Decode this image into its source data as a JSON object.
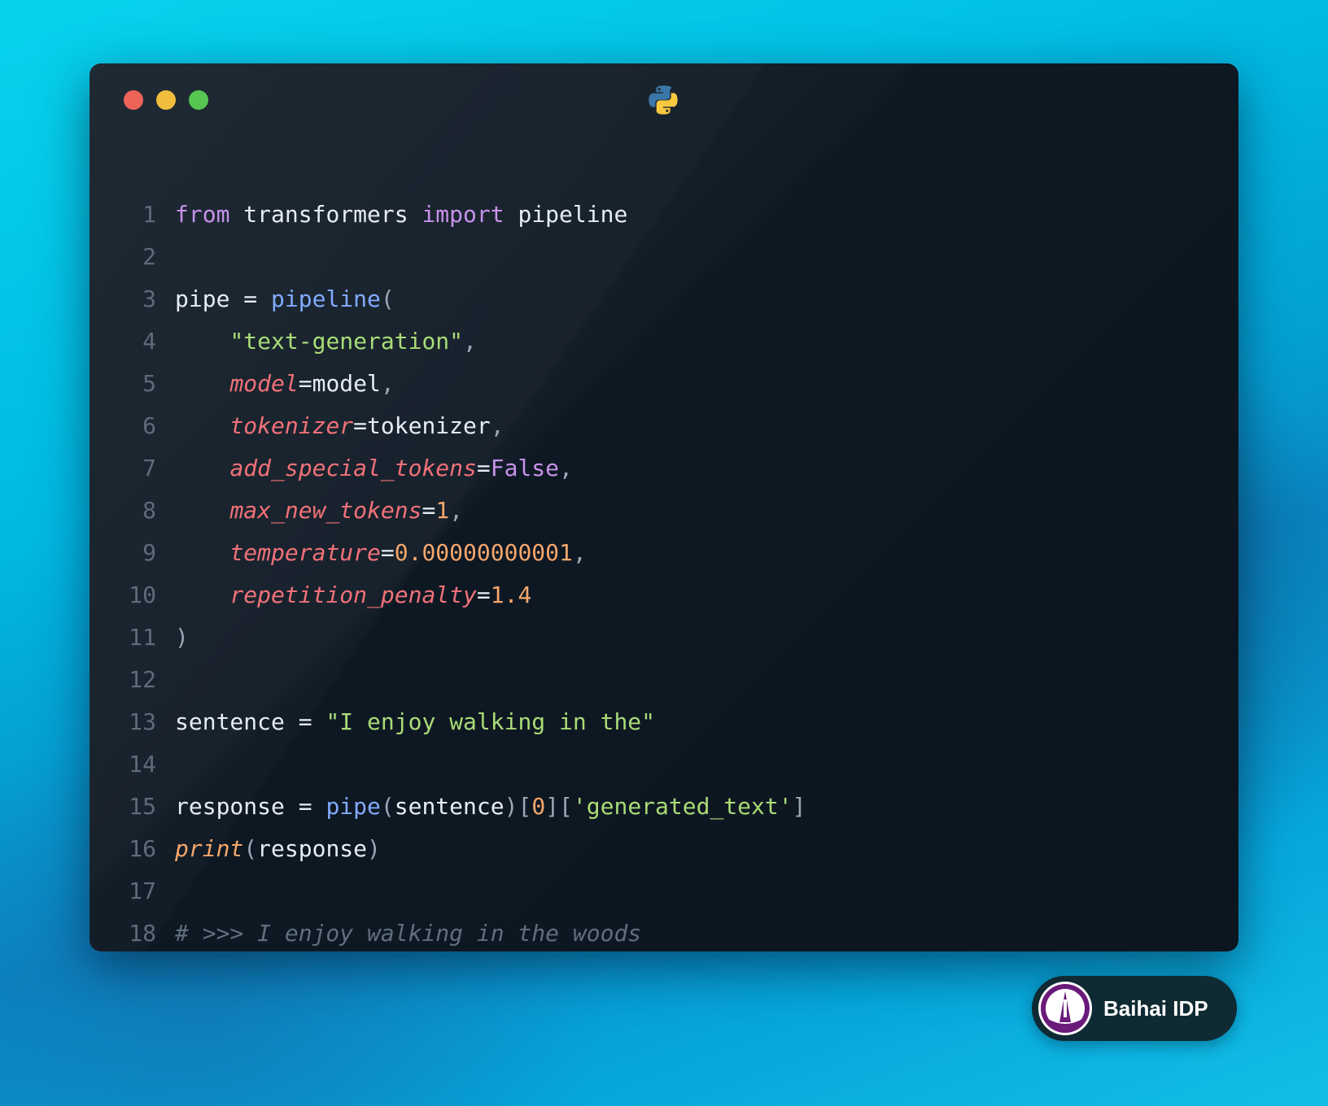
{
  "window": {
    "traffic_lights": [
      "close",
      "minimize",
      "maximize"
    ],
    "title_icon": "python-logo-icon"
  },
  "code": {
    "lines": [
      {
        "n": "1",
        "tokens": [
          {
            "t": "from",
            "c": "kw"
          },
          {
            "t": " transformers ",
            "c": "plain"
          },
          {
            "t": "import",
            "c": "kw"
          },
          {
            "t": " pipeline",
            "c": "plain"
          }
        ]
      },
      {
        "n": "2",
        "tokens": []
      },
      {
        "n": "3",
        "tokens": [
          {
            "t": "pipe ",
            "c": "plain"
          },
          {
            "t": "=",
            "c": "plain"
          },
          {
            "t": " ",
            "c": "plain"
          },
          {
            "t": "pipeline",
            "c": "fn"
          },
          {
            "t": "(",
            "c": "punc"
          }
        ]
      },
      {
        "n": "4",
        "tokens": [
          {
            "t": "    ",
            "c": "plain"
          },
          {
            "t": "\"text-generation\"",
            "c": "str"
          },
          {
            "t": ",",
            "c": "punc"
          }
        ]
      },
      {
        "n": "5",
        "tokens": [
          {
            "t": "    ",
            "c": "plain"
          },
          {
            "t": "model",
            "c": "param"
          },
          {
            "t": "=",
            "c": "plain"
          },
          {
            "t": "model",
            "c": "plain"
          },
          {
            "t": ",",
            "c": "punc"
          }
        ]
      },
      {
        "n": "6",
        "tokens": [
          {
            "t": "    ",
            "c": "plain"
          },
          {
            "t": "tokenizer",
            "c": "param"
          },
          {
            "t": "=",
            "c": "plain"
          },
          {
            "t": "tokenizer",
            "c": "plain"
          },
          {
            "t": ",",
            "c": "punc"
          }
        ]
      },
      {
        "n": "7",
        "tokens": [
          {
            "t": "    ",
            "c": "plain"
          },
          {
            "t": "add_special_tokens",
            "c": "param"
          },
          {
            "t": "=",
            "c": "plain"
          },
          {
            "t": "False",
            "c": "bool"
          },
          {
            "t": ",",
            "c": "punc"
          }
        ]
      },
      {
        "n": "8",
        "tokens": [
          {
            "t": "    ",
            "c": "plain"
          },
          {
            "t": "max_new_tokens",
            "c": "param"
          },
          {
            "t": "=",
            "c": "plain"
          },
          {
            "t": "1",
            "c": "num"
          },
          {
            "t": ",",
            "c": "punc"
          }
        ]
      },
      {
        "n": "9",
        "tokens": [
          {
            "t": "    ",
            "c": "plain"
          },
          {
            "t": "temperature",
            "c": "param"
          },
          {
            "t": "=",
            "c": "plain"
          },
          {
            "t": "0.00000000001",
            "c": "num"
          },
          {
            "t": ",",
            "c": "punc"
          }
        ]
      },
      {
        "n": "10",
        "tokens": [
          {
            "t": "    ",
            "c": "plain"
          },
          {
            "t": "repetition_penalty",
            "c": "param"
          },
          {
            "t": "=",
            "c": "plain"
          },
          {
            "t": "1.4",
            "c": "num"
          }
        ]
      },
      {
        "n": "11",
        "tokens": [
          {
            "t": ")",
            "c": "punc"
          }
        ]
      },
      {
        "n": "12",
        "tokens": []
      },
      {
        "n": "13",
        "tokens": [
          {
            "t": "sentence ",
            "c": "plain"
          },
          {
            "t": "=",
            "c": "plain"
          },
          {
            "t": " ",
            "c": "plain"
          },
          {
            "t": "\"I enjoy walking in the\"",
            "c": "str"
          }
        ]
      },
      {
        "n": "14",
        "tokens": []
      },
      {
        "n": "15",
        "tokens": [
          {
            "t": "response ",
            "c": "plain"
          },
          {
            "t": "=",
            "c": "plain"
          },
          {
            "t": " ",
            "c": "plain"
          },
          {
            "t": "pipe",
            "c": "fn"
          },
          {
            "t": "(",
            "c": "punc"
          },
          {
            "t": "sentence",
            "c": "plain"
          },
          {
            "t": ")[",
            "c": "punc"
          },
          {
            "t": "0",
            "c": "num"
          },
          {
            "t": "][",
            "c": "punc"
          },
          {
            "t": "'generated_text'",
            "c": "str"
          },
          {
            "t": "]",
            "c": "punc"
          }
        ]
      },
      {
        "n": "16",
        "tokens": [
          {
            "t": "print",
            "c": "builtin"
          },
          {
            "t": "(",
            "c": "punc"
          },
          {
            "t": "response",
            "c": "plain"
          },
          {
            "t": ")",
            "c": "punc"
          }
        ]
      },
      {
        "n": "17",
        "tokens": []
      },
      {
        "n": "18",
        "tokens": [
          {
            "t": "# >>> I enjoy walking in the woods",
            "c": "comment"
          }
        ]
      }
    ]
  },
  "badge": {
    "label": "Baihai IDP"
  },
  "colors": {
    "keyword": "#c792ea",
    "function": "#82aaff",
    "string": "#a9dc76",
    "parameter": "#f07178",
    "number": "#f5a76c",
    "comment": "#5f6f7f",
    "line_number": "#5d6b7a"
  }
}
